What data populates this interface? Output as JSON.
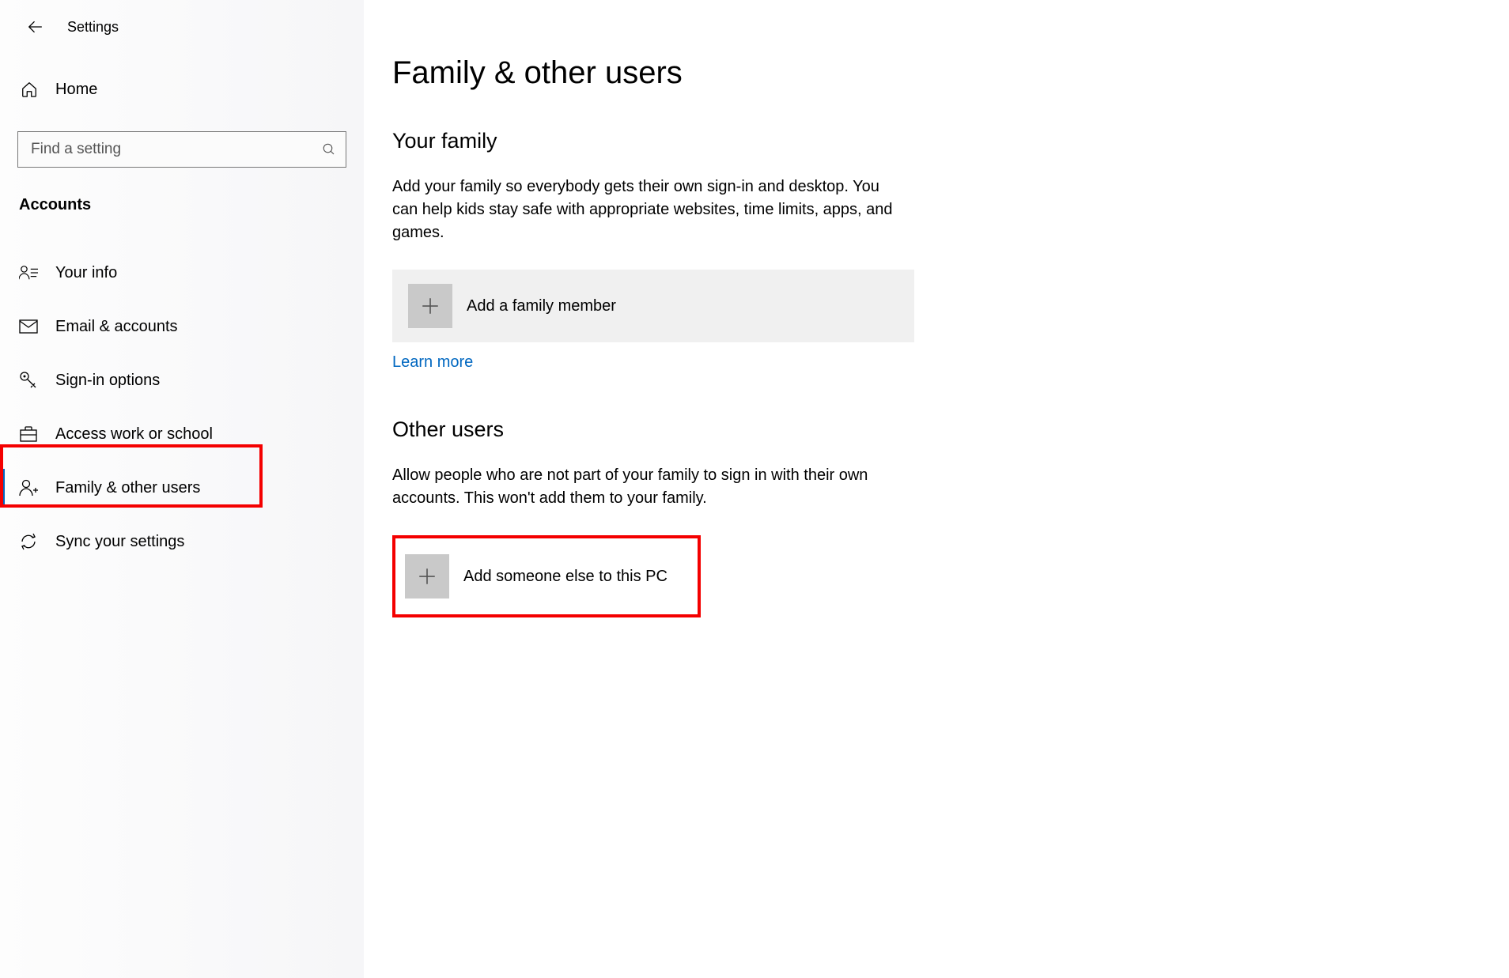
{
  "header": {
    "settings_label": "Settings"
  },
  "sidebar": {
    "home_label": "Home",
    "search_placeholder": "Find a setting",
    "section_heading": "Accounts",
    "items": [
      {
        "id": "your-info",
        "label": "Your info"
      },
      {
        "id": "email-accounts",
        "label": "Email & accounts"
      },
      {
        "id": "signin-options",
        "label": "Sign-in options"
      },
      {
        "id": "access-work-school",
        "label": "Access work or school"
      },
      {
        "id": "family-other-users",
        "label": "Family & other users"
      },
      {
        "id": "sync-settings",
        "label": "Sync your settings"
      }
    ]
  },
  "main": {
    "page_title": "Family & other users",
    "family": {
      "heading": "Your family",
      "body": "Add your family so everybody gets their own sign-in and desktop. You can help kids stay safe with appropriate websites, time limits, apps, and games.",
      "add_label": "Add a family member",
      "learn_more": "Learn more"
    },
    "other_users": {
      "heading": "Other users",
      "body": "Allow people who are not part of your family to sign in with their own accounts. This won't add them to your family.",
      "add_label": "Add someone else to this PC"
    }
  }
}
